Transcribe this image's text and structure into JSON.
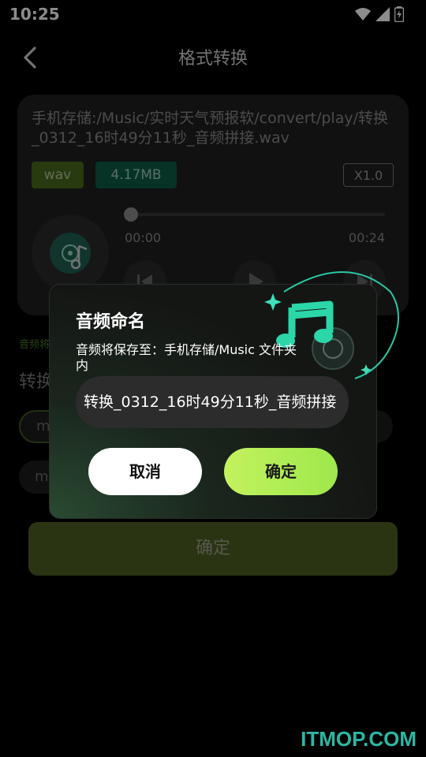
{
  "status_bar": {
    "time": "10:25"
  },
  "header": {
    "title": "格式转换"
  },
  "file": {
    "path": "手机存储:/Music/实时天气预报软/convert/play/转换_0312_16时49分11秒_音频拼接.wav",
    "format_tag": "wav",
    "size_tag": "4.17MB",
    "speed": "X1.0"
  },
  "player": {
    "current_time": "00:00",
    "total_time": "00:24",
    "progress": 0
  },
  "convert_section": {
    "small_label": "音频将",
    "label": "转换",
    "chip_1": "m",
    "chip_2": "m"
  },
  "confirm_button": "确定",
  "dialog": {
    "title": "音频命名",
    "description": "音频将保存至：手机存储/Music 文件夹内",
    "file_name": "转换_0312_16时49分11秒_音频拼接",
    "cancel": "取消",
    "ok": "确定"
  },
  "watermark": "ITMOP.COM",
  "colors": {
    "accent": "#b4ee57",
    "teal": "#2bc7a4",
    "tag_green": "#4a6a1e"
  }
}
